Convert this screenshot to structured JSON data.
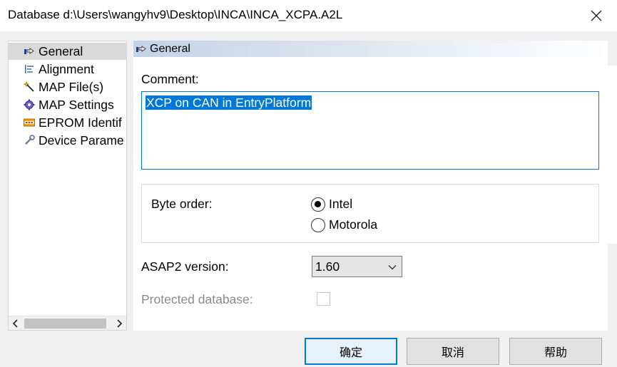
{
  "window": {
    "title": "Database d:\\Users\\wangyhv9\\Desktop\\INCA\\INCA_XCPA.A2L",
    "close_icon": "close-icon"
  },
  "nav": {
    "items": [
      {
        "label": "General",
        "icon": "hand-pointer-icon",
        "selected": true
      },
      {
        "label": "Alignment",
        "icon": "align-left-icon",
        "selected": false
      },
      {
        "label": "MAP File(s)",
        "icon": "wand-icon",
        "selected": false
      },
      {
        "label": "MAP Settings",
        "icon": "gear-icon",
        "selected": false
      },
      {
        "label": "EPROM Identif",
        "icon": "epk-icon",
        "selected": false
      },
      {
        "label": "Device Parame",
        "icon": "wrench-icon",
        "selected": false
      }
    ],
    "scroll_left_icon": "chevron-left-icon",
    "scroll_right_icon": "chevron-right-icon"
  },
  "section": {
    "title": "General",
    "icon": "hand-pointer-icon"
  },
  "comment": {
    "label": "Comment:",
    "value": "XCP on CAN in EntryPlatform"
  },
  "byte_order": {
    "label": "Byte order:",
    "options": [
      {
        "label": "Intel",
        "checked": true
      },
      {
        "label": "Motorola",
        "checked": false
      }
    ]
  },
  "asap2": {
    "label": "ASAP2 version:",
    "selected": "1.60"
  },
  "protected": {
    "label": "Protected database:",
    "checked": false
  },
  "buttons": {
    "ok": "确定",
    "cancel": "取消",
    "help": "帮助"
  },
  "colors": {
    "accent": "#0078d7",
    "selected_bg": "#d9d9d9",
    "header_gradient_start": "#c4d2e6"
  }
}
